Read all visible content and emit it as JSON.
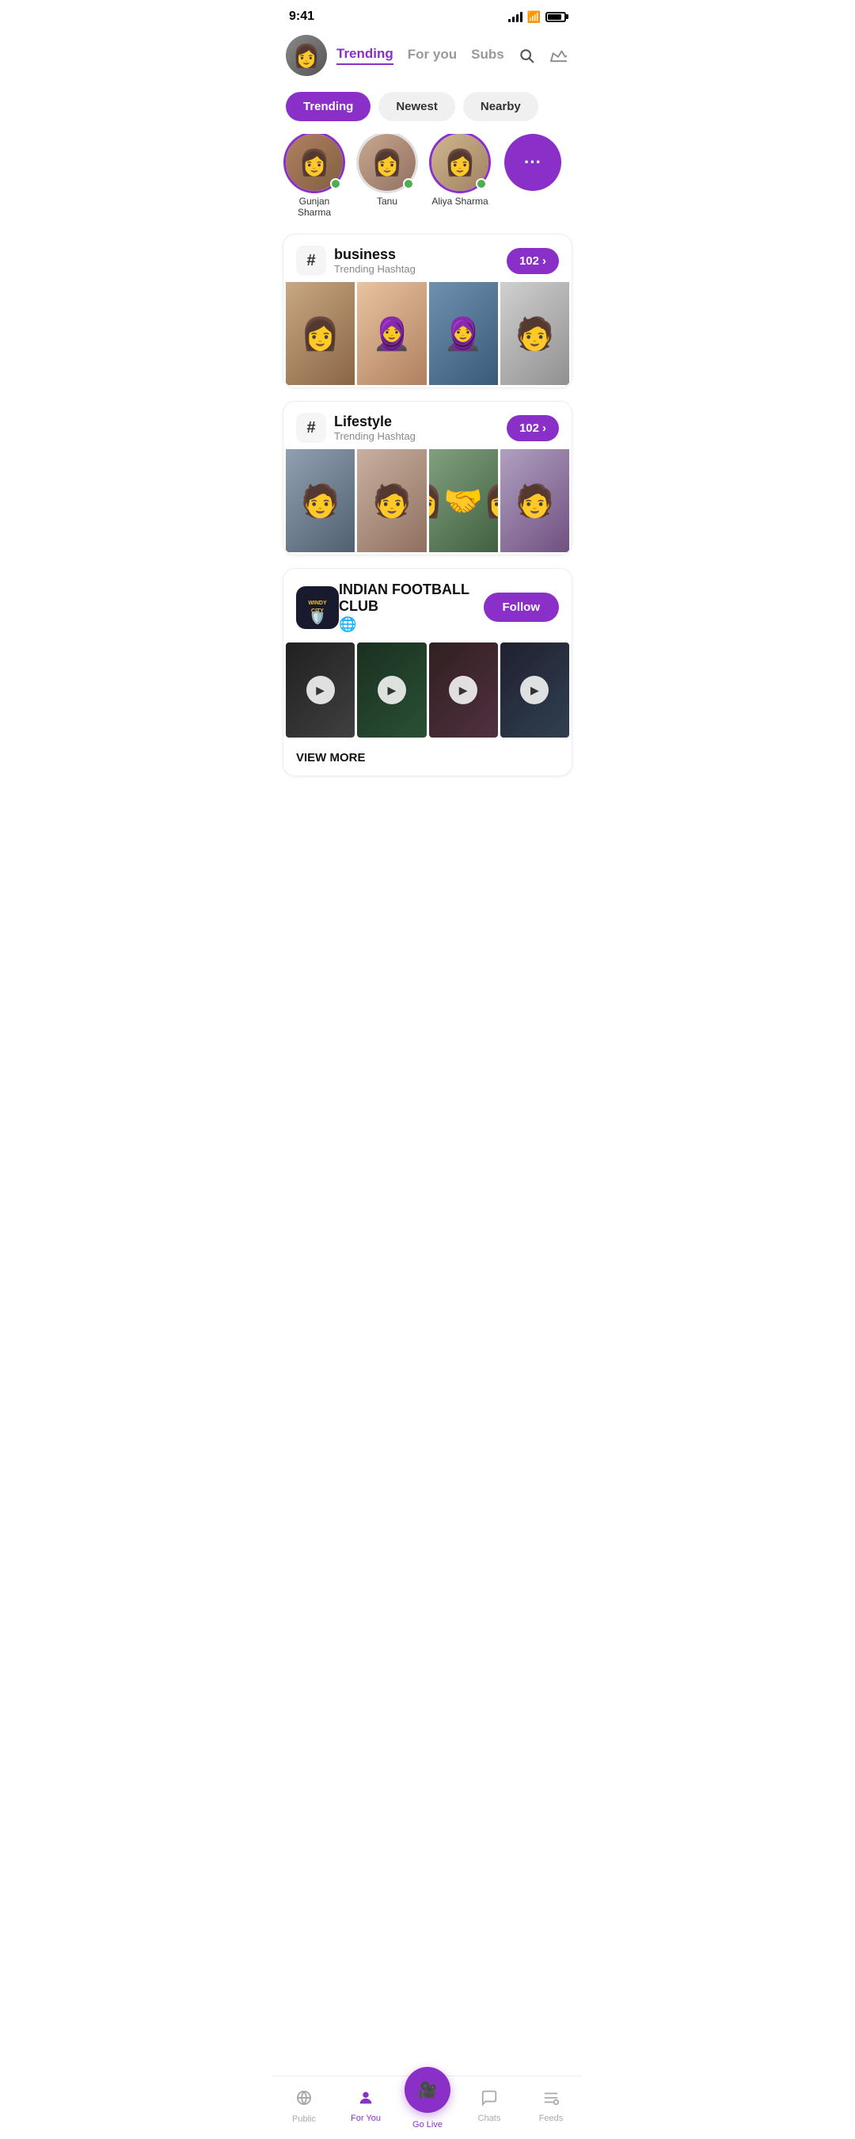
{
  "statusBar": {
    "time": "9:41",
    "battery": "85%"
  },
  "header": {
    "tabs": [
      {
        "id": "trending",
        "label": "Trending",
        "active": true
      },
      {
        "id": "foryou",
        "label": "For you",
        "active": false
      },
      {
        "id": "subs",
        "label": "Subs",
        "active": false
      }
    ],
    "searchLabel": "search",
    "crownLabel": "premium"
  },
  "filterTabs": [
    {
      "id": "trending",
      "label": "Trending",
      "active": true
    },
    {
      "id": "newest",
      "label": "Newest",
      "active": false
    },
    {
      "id": "nearby",
      "label": "Nearby",
      "active": false
    }
  ],
  "stories": [
    {
      "id": "gunjan",
      "name": "Gunjan Sharma",
      "online": true,
      "hasRing": true
    },
    {
      "id": "tanu",
      "name": "Tanu",
      "online": true,
      "hasRing": false
    },
    {
      "id": "aliya",
      "name": "Aliya Sharma",
      "online": true,
      "hasRing": true
    },
    {
      "id": "more",
      "name": "",
      "isMore": true,
      "dots": "···"
    }
  ],
  "hashtagCards": [
    {
      "id": "business",
      "tag": "business",
      "sub": "Trending Hashtag",
      "count": "102",
      "images": [
        "img-p1",
        "img-p2",
        "img-p3",
        "img-p4"
      ]
    },
    {
      "id": "lifestyle",
      "tag": "Lifestyle",
      "sub": "Trending Hashtag",
      "count": "102",
      "images": [
        "img-p5",
        "img-p6",
        "img-p7",
        "img-p8"
      ]
    }
  ],
  "clubCard": {
    "logoLine1": "WINDY",
    "logoLine2": "city",
    "name": "INDIAN FOOTBALL CLUB",
    "followLabel": "Follow",
    "viewMore": "VIEW MORE",
    "videos": [
      "cv1",
      "cv2",
      "cv3",
      "cv4"
    ]
  },
  "bottomNav": [
    {
      "id": "public",
      "icon": "📡",
      "label": "Public",
      "active": false
    },
    {
      "id": "foryou",
      "icon": "👤",
      "label": "For You",
      "active": true
    },
    {
      "id": "golive",
      "icon": "🎥",
      "label": "Go Live",
      "isCenter": true
    },
    {
      "id": "chats",
      "icon": "💬",
      "label": "Chats",
      "active": false
    },
    {
      "id": "feeds",
      "icon": "📋",
      "label": "Feeds",
      "active": false
    }
  ]
}
